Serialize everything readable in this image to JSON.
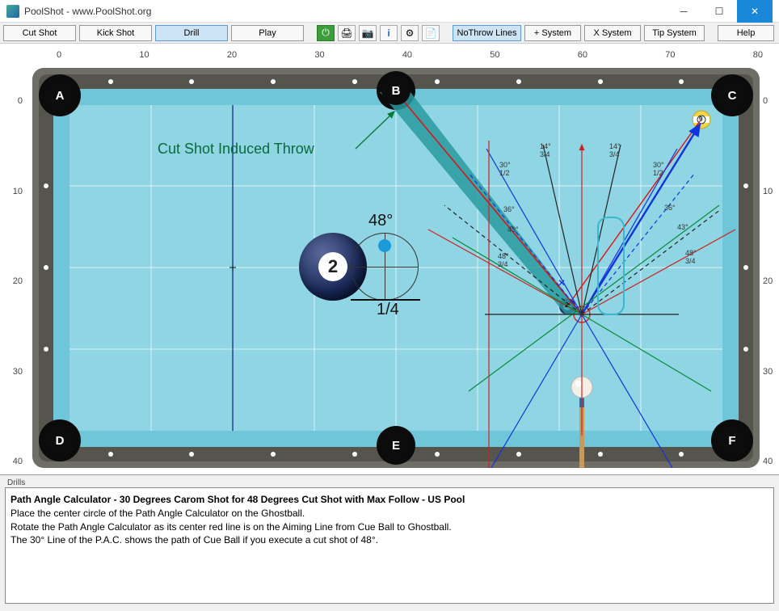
{
  "window": {
    "title": "PoolShot - www.PoolShot.org"
  },
  "toolbar": {
    "cut_shot": "Cut Shot",
    "kick_shot": "Kick Shot",
    "drill": "Drill",
    "play": "Play",
    "no_throw": "NoThrow Lines",
    "plus_sys": "+ System",
    "x_sys": "X System",
    "tip_sys": "Tip System",
    "help": "Help"
  },
  "ruler": {
    "top": [
      "0",
      "10",
      "20",
      "30",
      "40",
      "50",
      "60",
      "70",
      "80"
    ],
    "side": [
      "0",
      "10",
      "20",
      "30",
      "40"
    ]
  },
  "pockets": {
    "a": "A",
    "b": "B",
    "c": "C",
    "d": "D",
    "e": "E",
    "f": "F"
  },
  "inset": {
    "angle": "48°",
    "fraction": "1/4"
  },
  "annotation": {
    "throw": "Cut Shot Induced Throw"
  },
  "fan": {
    "l30": "30°",
    "l30s": "1/2",
    "l36": "36°",
    "l43": "43°",
    "l48": "48°",
    "l48s": "3/4",
    "l14": "14°",
    "l14s": "3/4"
  },
  "balls": {
    "two": "2",
    "nine": "9"
  },
  "drills": {
    "tab": "Drills",
    "title": "Path Angle Calculator - 30 Degrees Carom Shot for 48 Degrees Cut Shot with Max Follow - US Pool",
    "l1": "Place the center circle of the Path Angle Calculator on the Ghostball.",
    "l2": "Rotate the Path Angle Calculator as its center red line is on the Aiming Line from Cue Ball to Ghostball.",
    "l3": "The 30° Line of the P.A.C. shows the path of Cue Ball if you execute a cut shot of 48°."
  }
}
